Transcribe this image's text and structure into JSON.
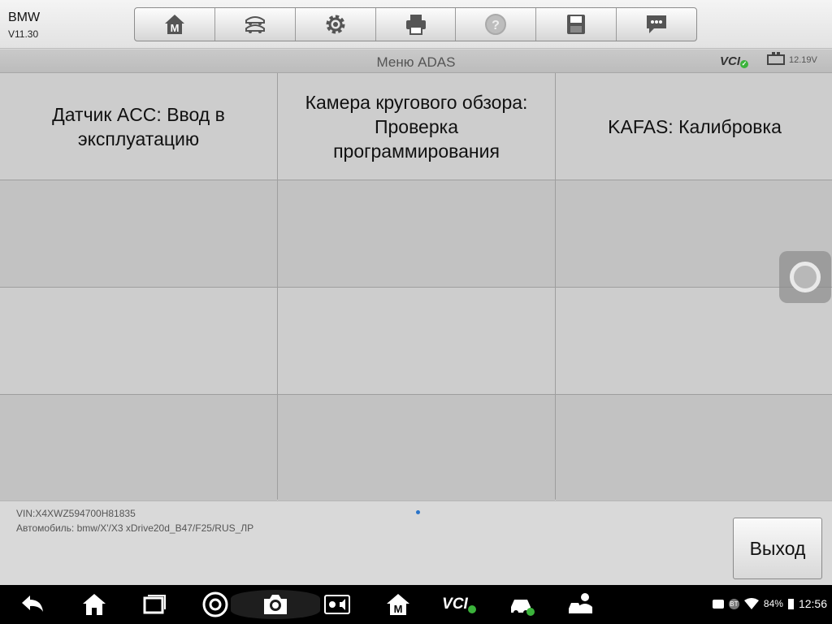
{
  "header": {
    "make": "BMW",
    "version": "V11.30",
    "tools": [
      {
        "name": "home-m-icon"
      },
      {
        "name": "vehicle-swap-icon"
      },
      {
        "name": "gear-icon"
      },
      {
        "name": "printer-icon"
      },
      {
        "name": "help-icon"
      },
      {
        "name": "save-icon"
      },
      {
        "name": "message-icon"
      }
    ]
  },
  "titlebar": {
    "title": "Меню ADAS",
    "vci_label": "VCI",
    "vci_ok": "✓",
    "voltage": "12.19V"
  },
  "menu": {
    "items": [
      {
        "label": "Датчик ACC: Ввод в эксплуатацию"
      },
      {
        "label": "Камера кругового обзора: Проверка программирования"
      },
      {
        "label": "KAFAS: Калибровка"
      }
    ]
  },
  "footer": {
    "vin": "VIN:X4XWZ594700H81835",
    "vehicle": "Автомобиль: bmw/X'/X3 xDrive20d_B47/F25/RUS_ЛР",
    "exit_label": "Выход"
  },
  "system": {
    "vci_label": "VCI",
    "bt": "BT",
    "battery": "84%",
    "time": "12:56"
  },
  "colors": {
    "toolbar_bg": "#e9e9e9",
    "cell_bg": "#cdcdcd",
    "nav_bg": "#000000",
    "ok_green": "#3bb33b"
  }
}
